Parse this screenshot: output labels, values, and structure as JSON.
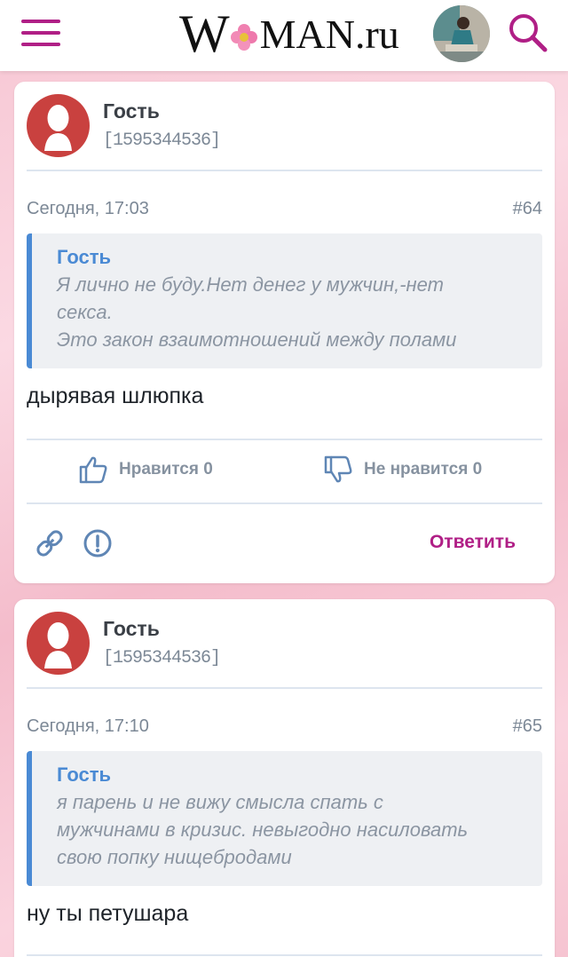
{
  "header": {
    "logo_big": "W",
    "logo_rest": "MAN.ru",
    "brand_color": "#b01f86"
  },
  "posts": [
    {
      "author": "Гость",
      "user_id": "[1595344536]",
      "date": "Сегодня, 17:03",
      "number": "#64",
      "quote_author": "Гость",
      "quote_text": "Я лично не буду.Нет денег у мужчин,-нет\nсекса.\nЭто закон взаимотношений между полами",
      "text": "дырявая шлюпка",
      "like_label": "Нравится 0",
      "dislike_label": "Не нравится 0",
      "reply_label": "Ответить"
    },
    {
      "author": "Гость",
      "user_id": "[1595344536]",
      "date": "Сегодня, 17:10",
      "number": "#65",
      "quote_author": "Гость",
      "quote_text": "я парень и не вижу смысла спать с\nмужчинами в кризис. невыгодно насиловать\nсвою попку нищебродами",
      "text": "ну ты петушара"
    }
  ]
}
